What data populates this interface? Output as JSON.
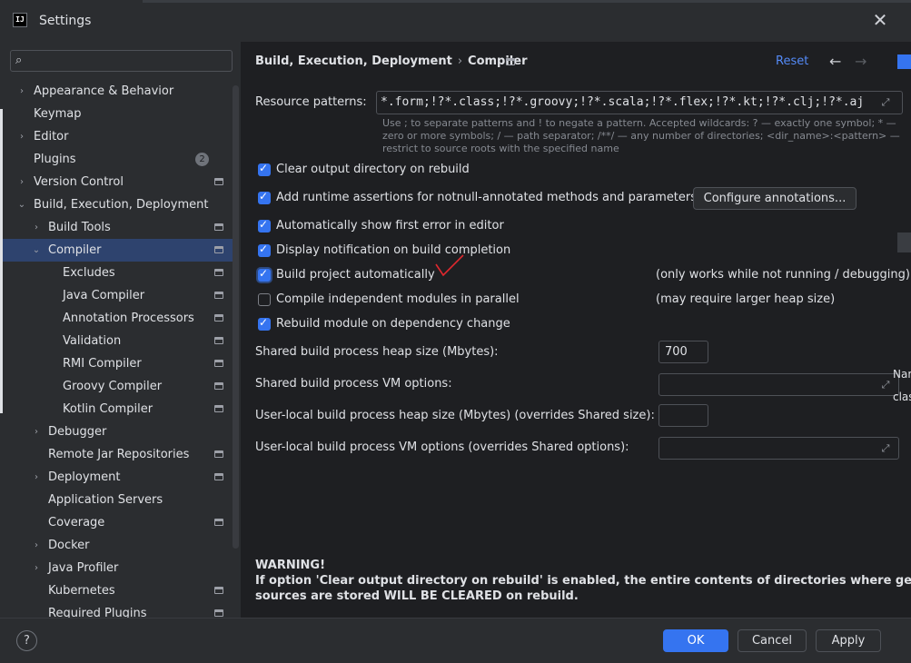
{
  "window": {
    "title": "Settings",
    "logo": "IJ",
    "close_glyph": "✕"
  },
  "search": {
    "value": "",
    "placeholder": ""
  },
  "sidebar": {
    "items": [
      {
        "label": "Appearance & Behavior",
        "level": 0,
        "chevron": "›"
      },
      {
        "label": "Keymap",
        "level": 0
      },
      {
        "label": "Editor",
        "level": 0,
        "chevron": "›"
      },
      {
        "label": "Plugins",
        "level": 0,
        "badge": "2"
      },
      {
        "label": "Version Control",
        "level": 0,
        "chevron": "›",
        "project": true
      },
      {
        "label": "Build, Execution, Deployment",
        "level": 0,
        "chevron": "⌄"
      },
      {
        "label": "Build Tools",
        "level": 1,
        "chevron": "›",
        "project": true
      },
      {
        "label": "Compiler",
        "level": 1,
        "chevron": "⌄",
        "project": true,
        "selected": true
      },
      {
        "label": "Excludes",
        "level": 2,
        "project": true
      },
      {
        "label": "Java Compiler",
        "level": 2,
        "project": true
      },
      {
        "label": "Annotation Processors",
        "level": 2,
        "project": true
      },
      {
        "label": "Validation",
        "level": 2,
        "project": true
      },
      {
        "label": "RMI Compiler",
        "level": 2,
        "project": true
      },
      {
        "label": "Groovy Compiler",
        "level": 2,
        "project": true
      },
      {
        "label": "Kotlin Compiler",
        "level": 2,
        "project": true
      },
      {
        "label": "Debugger",
        "level": 1,
        "chevron": "›"
      },
      {
        "label": "Remote Jar Repositories",
        "level": 1,
        "project": true
      },
      {
        "label": "Deployment",
        "level": 1,
        "chevron": "›",
        "project": true
      },
      {
        "label": "Application Servers",
        "level": 1
      },
      {
        "label": "Coverage",
        "level": 1,
        "project": true
      },
      {
        "label": "Docker",
        "level": 1,
        "chevron": "›"
      },
      {
        "label": "Java Profiler",
        "level": 1,
        "chevron": "›"
      },
      {
        "label": "Kubernetes",
        "level": 1,
        "project": true
      },
      {
        "label": "Required Plugins",
        "level": 1,
        "project": true
      }
    ]
  },
  "header": {
    "crumb_parent": "Build, Execution, Deployment",
    "crumb_sep": "›",
    "crumb_current": "Compiler",
    "reset": "Reset",
    "back": "←",
    "forward": "→"
  },
  "resource": {
    "label": "Resource patterns:",
    "value": "*.form;!?*.class;!?*.groovy;!?*.scala;!?*.flex;!?*.kt;!?*.clj;!?*.aj",
    "hint": "Use ; to separate patterns and ! to negate a pattern. Accepted wildcards: ? — exactly one symbol; * — zero or more symbols; / — path separator; /**/ — any number of directories; <dir_name>:<pattern> — restrict to source roots with the specified name"
  },
  "options": {
    "clear_output": {
      "label": "Clear output directory on rebuild",
      "checked": true
    },
    "runtime_assertions": {
      "label": "Add runtime assertions for notnull-annotated methods and parameters",
      "checked": true
    },
    "configure_annotations": "Configure annotations...",
    "show_first_error": {
      "label": "Automatically show first error in editor",
      "checked": true
    },
    "notify_build": {
      "label": "Display notification on build completion",
      "checked": true
    },
    "build_auto": {
      "label": "Build project automatically",
      "checked": true,
      "note": "(only works while not running / debugging)"
    },
    "parallel": {
      "label": "Compile independent modules in parallel",
      "checked": false,
      "note": "(may require larger heap size)"
    },
    "rebuild_dep": {
      "label": "Rebuild module on dependency change",
      "checked": true
    }
  },
  "fields": {
    "shared_heap": {
      "label": "Shared build process heap size (Mbytes):",
      "value": "700"
    },
    "shared_vm": {
      "label": "Shared build process VM options:",
      "value": ""
    },
    "local_heap": {
      "label": "User-local build process heap size (Mbytes) (overrides Shared size):",
      "value": ""
    },
    "local_vm": {
      "label": "User-local build process VM options (overrides Shared options):",
      "value": ""
    }
  },
  "warning": {
    "title": "WARNING!",
    "line1": "If option 'Clear output directory on rebuild' is enabled, the entire contents of directories where generated",
    "line2": "sources are stored WILL BE CLEARED on rebuild."
  },
  "footer": {
    "help": "?",
    "ok": "OK",
    "cancel": "Cancel",
    "apply": "Apply"
  },
  "edge": {
    "text1": "Nar",
    "text2": "clas"
  },
  "colors": {
    "accent": "#3574f0",
    "link": "#548af7",
    "selection": "#2e436e",
    "annotation_mark": "#e0282e"
  }
}
